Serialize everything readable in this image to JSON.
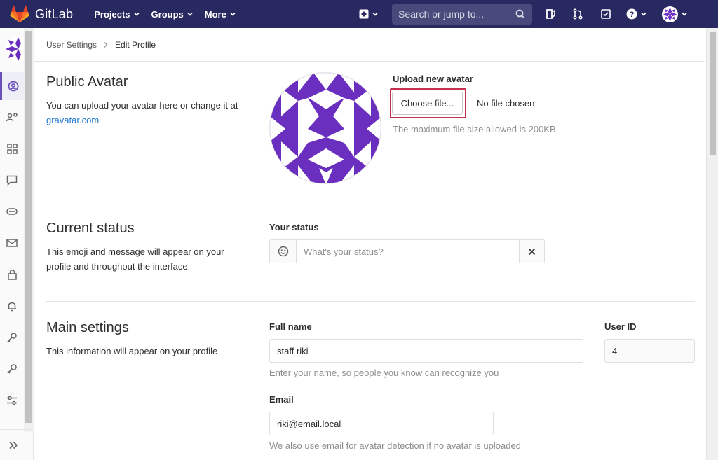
{
  "navbar": {
    "brand": "GitLab",
    "menu": [
      {
        "label": "Projects"
      },
      {
        "label": "Groups"
      },
      {
        "label": "More"
      }
    ],
    "search_placeholder": "Search or jump to..."
  },
  "breadcrumb": {
    "parent": "User Settings",
    "current": "Edit Profile"
  },
  "avatar_section": {
    "title": "Public Avatar",
    "desc_prefix": "You can upload your avatar here or change it at ",
    "desc_link": "gravatar.com",
    "upload_label": "Upload new avatar",
    "choose_button": "Choose file...",
    "no_file_text": "No file chosen",
    "max_size_help": "The maximum file size allowed is 200KB."
  },
  "status_section": {
    "title": "Current status",
    "desc": "This emoji and message will appear on your profile and throughout the interface.",
    "field_label": "Your status",
    "placeholder": "What's your status?"
  },
  "main_section": {
    "title": "Main settings",
    "desc": "This information will appear on your profile",
    "full_name_label": "Full name",
    "full_name_value": "staff riki",
    "full_name_help": "Enter your name, so people you know can recognize you",
    "user_id_label": "User ID",
    "user_id_value": "4",
    "email_label": "Email",
    "email_value": "riki@email.local",
    "email_help": "We also use email for avatar detection if no avatar is uploaded"
  },
  "colors": {
    "navbar": "#292961",
    "accent": "#6b4fbb",
    "avatar_purple": "#6b2fc0",
    "highlight": "#c4314b"
  }
}
